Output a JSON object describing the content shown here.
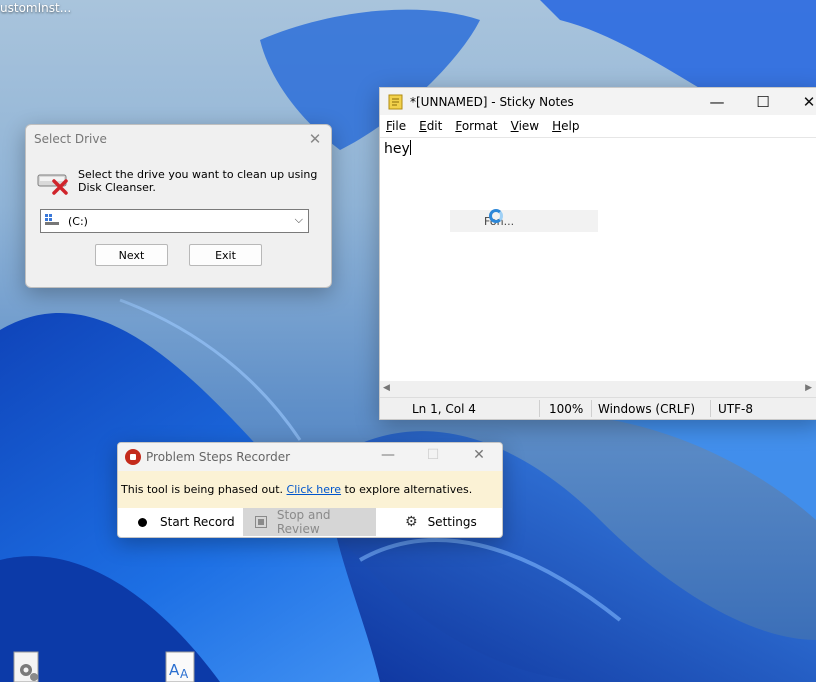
{
  "desktop": {
    "top_left_label": "ustomInst...",
    "icons": [
      {
        "name": "settings-doc-icon"
      },
      {
        "name": "font-doc-icon"
      }
    ]
  },
  "select_drive": {
    "title": "Select Drive",
    "close_glyph": "✕",
    "message": "Select the drive you want to clean up using Disk Cleanser.",
    "drive_value": "(C:)",
    "next_label": "Next",
    "exit_label": "Exit"
  },
  "sticky_notes": {
    "title": "*[UNNAMED] - Sticky Notes",
    "minimize_glyph": "—",
    "maximize_glyph": "☐",
    "close_glyph": "✕",
    "menu": [
      "File",
      "Edit",
      "Format",
      "View",
      "Help"
    ],
    "content": "hey",
    "tooltip": "Fon...",
    "status": {
      "position": "Ln 1, Col 4",
      "zoom": "100%",
      "line_ending": "Windows (CRLF)",
      "encoding": "UTF-8"
    }
  },
  "psr": {
    "title": "Problem Steps Recorder",
    "minimize_glyph": "—",
    "maximize_glyph": "☐",
    "close_glyph": "✕",
    "banner_before": "This tool is being phased out. ",
    "banner_link": "Click here",
    "banner_after": " to explore alternatives.",
    "start_record": "Start Record",
    "stop_review": "Stop and Review",
    "settings": "Settings"
  },
  "colors": {
    "record_red": "#c42b1c",
    "banner_bg": "#fbf2d5",
    "link_blue": "#0055cc",
    "wallpaper_blue": "#1f5fd1"
  }
}
